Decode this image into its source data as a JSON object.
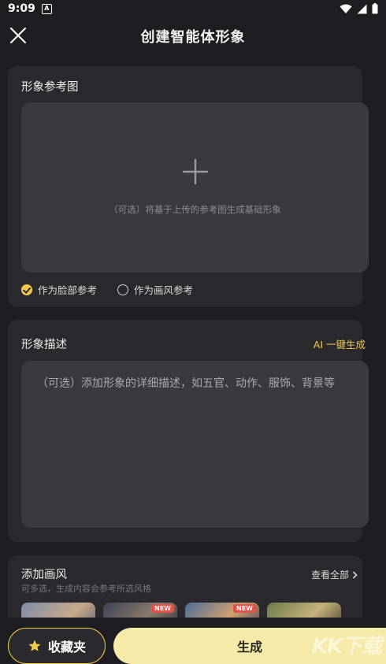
{
  "status": {
    "time": "9:09",
    "app_badge": "A"
  },
  "header": {
    "title": "创建智能体形象"
  },
  "reference": {
    "title": "形象参考图",
    "hint": "（可选）将基于上传的参考图生成基础形象",
    "options": [
      {
        "label": "作为脸部参考",
        "selected": true
      },
      {
        "label": "作为画风参考",
        "selected": false
      }
    ]
  },
  "description": {
    "title": "形象描述",
    "ai_button": "AI 一键生成",
    "placeholder": "（可选）添加形象的详细描述，如五官、动作、服饰、背景等"
  },
  "style": {
    "title": "添加画风",
    "subtitle": "可多选，生成内容会参考所选风格",
    "view_all": "查看全部",
    "thumbnails": [
      {
        "badge": ""
      },
      {
        "badge": "NEW"
      },
      {
        "badge": "NEW"
      },
      {
        "badge": ""
      },
      {
        "badge": ""
      }
    ]
  },
  "bottom": {
    "favorites_label": "收藏夹",
    "generate_label": "生成"
  },
  "watermark": "KK下载",
  "colors": {
    "accent": "#f2c94c",
    "background": "#1e1e22",
    "card": "#2a2a2e",
    "input": "#3a3a3e",
    "generate": "#f6eaa8"
  }
}
